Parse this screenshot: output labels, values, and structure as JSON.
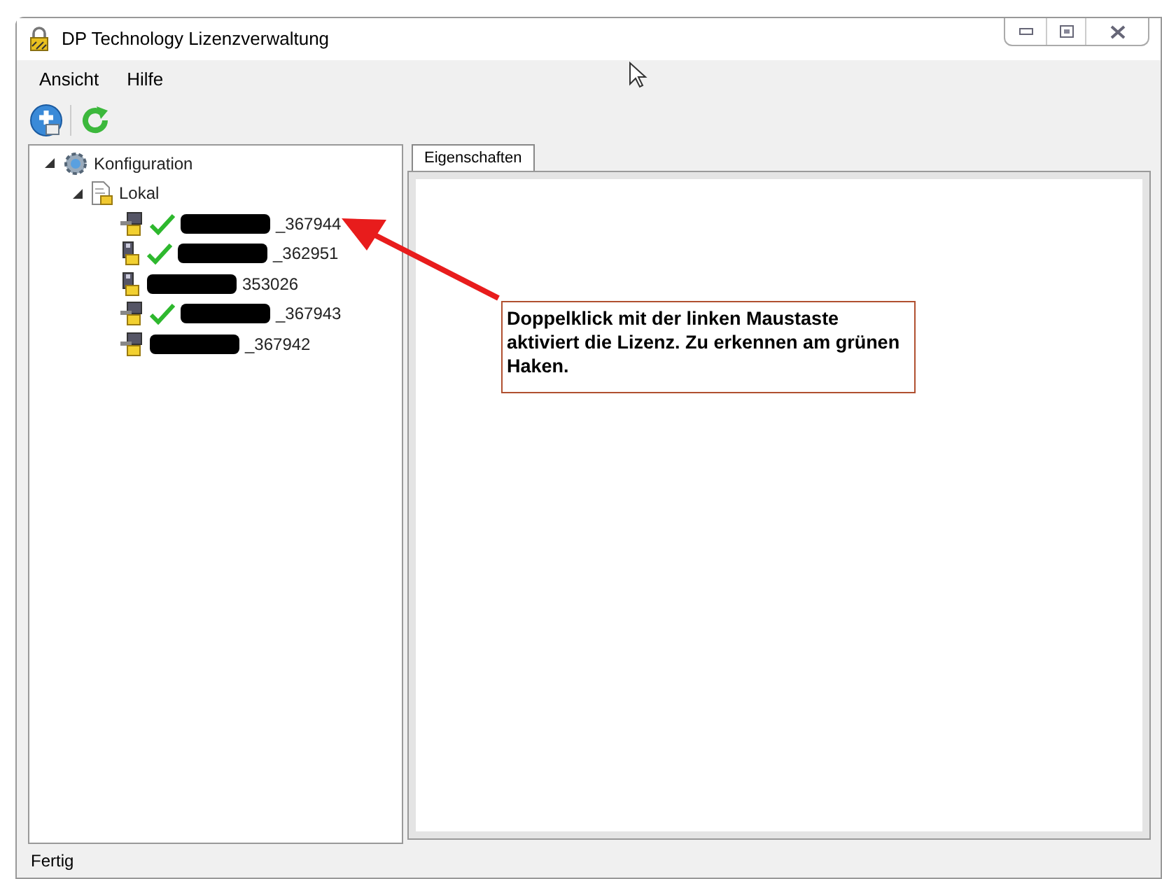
{
  "window": {
    "title": "DP Technology Lizenzverwaltung"
  },
  "menu": [
    "Ansicht",
    "Hilfe"
  ],
  "tree": [
    {
      "label": "Konfiguration",
      "kind": "config",
      "expanded": true,
      "children": [
        {
          "label": "Lokal",
          "kind": "local",
          "expanded": true,
          "children": [
            {
              "label": "_367944",
              "kind": "network",
              "checked": true
            },
            {
              "label": "_362951",
              "kind": "dongle",
              "checked": true
            },
            {
              "label": "353026",
              "kind": "dongle",
              "checked": false
            },
            {
              "label": "_367943",
              "kind": "network",
              "checked": true
            },
            {
              "label": "_367942",
              "kind": "network",
              "checked": false
            }
          ]
        }
      ]
    }
  ],
  "tabs": [
    {
      "label": "Eigenschaften",
      "selected": true
    }
  ],
  "annotation": {
    "text": "Doppelklick mit der linken Maustaste aktiviert die Lizenz. Zu erkennen am grünen Haken."
  },
  "status_bar": "Fertig"
}
